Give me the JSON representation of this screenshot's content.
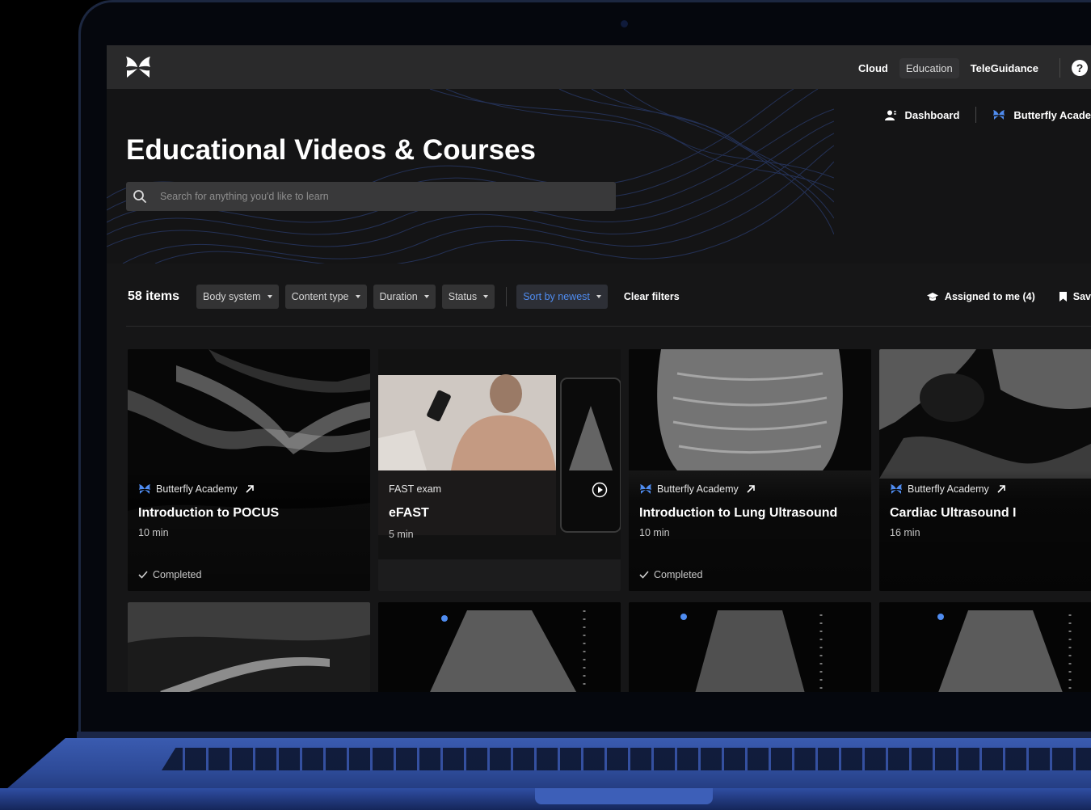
{
  "topnav": {
    "items": [
      {
        "label": "Cloud",
        "active": false
      },
      {
        "label": "Education",
        "active": true
      },
      {
        "label": "TeleGuidance",
        "active": false
      }
    ],
    "help_glyph": "?"
  },
  "subnav": {
    "dashboard_label": "Dashboard",
    "academy_label": "Butterfly Acade"
  },
  "hero": {
    "title": "Educational Videos & Courses",
    "search_placeholder": "Search for anything you'd like to learn"
  },
  "filters": {
    "count": "58 items",
    "chips": [
      "Body system",
      "Content type",
      "Duration",
      "Status"
    ],
    "sort_label": "Sort by newest",
    "clear_label": "Clear filters",
    "assigned_label": "Assigned to me (4)",
    "saved_label": "Sav"
  },
  "cards": [
    {
      "source": "Butterfly Academy",
      "title": "Introduction to POCUS",
      "duration": "10 min",
      "status": "Completed"
    },
    {
      "source": "FAST exam",
      "title": "eFAST",
      "duration": "5 min",
      "status": ""
    },
    {
      "source": "Butterfly Academy",
      "title": "Introduction to Lung Ultrasound",
      "duration": "10 min",
      "status": "Completed"
    },
    {
      "source": "Butterfly Academy",
      "title": "Cardiac Ultrasound I",
      "duration": "16 min",
      "status": ""
    }
  ],
  "theme": {
    "accent_blue": "#4f8cf0",
    "topbar_bg": "#2a2a2b",
    "page_bg": "#161617"
  },
  "icons": [
    "butterfly-logo-icon",
    "help-icon",
    "person-icon",
    "butterfly-icon",
    "search-icon",
    "caret-down-icon",
    "graduation-cap-icon",
    "bookmark-icon",
    "external-link-icon",
    "check-icon",
    "play-icon"
  ]
}
